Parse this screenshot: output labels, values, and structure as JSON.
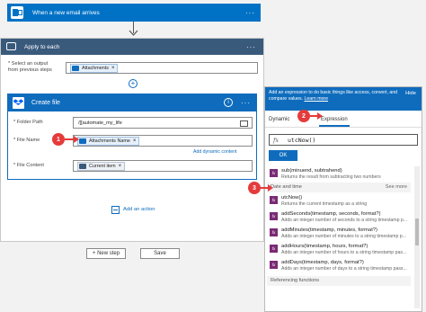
{
  "trigger": {
    "title": "When a new email arrives",
    "more": "···"
  },
  "loop": {
    "title": "Apply to each",
    "more": "···",
    "output_label": "* Select an output\nfrom previous steps",
    "output_token": "Attachments",
    "token_remove": "×"
  },
  "create_file": {
    "title": "Create file",
    "info": "i",
    "more": "···",
    "folder_label": "* Folder Path",
    "folder_value": "/[[automate_my_life",
    "filename_label": "* File Name",
    "filename_token": "Attachments Name",
    "content_label": "* File Content",
    "content_token": "Current item",
    "add_dynamic": "Add dynamic content"
  },
  "add_action": "Add an action",
  "new_step": "+ New step",
  "save": "Save",
  "panel": {
    "description": "Add an expression to do basic things like access, convert, and compare values.",
    "learn_more": "Learn more",
    "hide": "Hide",
    "tab_dynamic": "Dynamic",
    "tab_expression": "Expression",
    "fx_symbol": "fx",
    "expression_value": "utcNow()",
    "ok": "OK",
    "functions": {
      "sub": {
        "name": "sub(minuend, subtrahend)",
        "desc": "Returns the result from subtracting two numbers"
      },
      "section_date": "Date and time",
      "see_more": "See more",
      "utcnow": {
        "name": "utcNow()",
        "desc": "Returns the current timestamp as a string"
      },
      "addseconds": {
        "name": "addSeconds(timestamp, seconds, format?)",
        "desc": "Adds an integer number of seconds to a string timestamp p..."
      },
      "addminutes": {
        "name": "addMinutes(timestamp, minutes, format?)",
        "desc": "Adds an integer number of minutes to a string timestamp p..."
      },
      "addhours": {
        "name": "addHours(timestamp, hours, format?)",
        "desc": "Adds an integer number of hours to a string timestamp pas..."
      },
      "adddays": {
        "name": "addDays(timestamp, days, format?)",
        "desc": "Adds an integer number of days to a string timestamp pass..."
      },
      "section_ref": "Referencing functions"
    }
  },
  "callouts": {
    "one": "1",
    "two": "2",
    "three": "3"
  },
  "colors": {
    "outlook": "#0072c6",
    "loop": "#3a5a7c",
    "dropbox": "#0061fe",
    "fx": "#7a2a74",
    "callout": "#e53b3b",
    "accent": "#0f6cbd"
  },
  "icons": [
    "outlook-icon",
    "loop-icon",
    "dropbox-icon",
    "folder-icon",
    "info-icon",
    "insert-icon",
    "add-action-icon",
    "fx-icon"
  ]
}
